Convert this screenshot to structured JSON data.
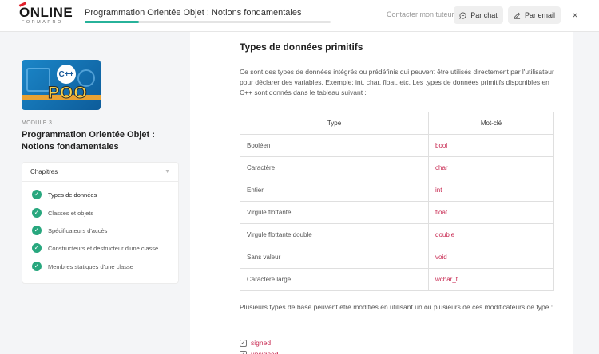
{
  "header": {
    "logo_main": "ONLINE",
    "logo_sub": "FORMAPRO",
    "course_title": "Programmation Orientée Objet : Notions fondamentales",
    "progress_fraction": 0.22,
    "contact_label": "Contacter mon tuteur :",
    "chat_label": "Par chat",
    "email_label": "Par email",
    "close_glyph": "×"
  },
  "sidebar": {
    "thumbnail_text": "POO",
    "thumbnail_badge": "C++",
    "module_label": "MODULE 3",
    "module_title": "Programmation Orientée Objet : Notions fondamentales",
    "chapters_label": "Chapitres",
    "chapters": [
      {
        "label": "Types de données",
        "active": true
      },
      {
        "label": "Classes et objets",
        "active": false
      },
      {
        "label": "Spécificateurs d'accès",
        "active": false
      },
      {
        "label": "Constructeurs et destructeur d'une classe",
        "active": false
      },
      {
        "label": "Membres statiques d'une classe",
        "active": false
      }
    ]
  },
  "content": {
    "title": "Types de données primitifs",
    "intro": "Ce sont des types de données intégrés ou prédéfinis qui peuvent être utilisés directement par l'utilisateur pour déclarer des variables. Exemple: int, char, float, etc. Les types de données primitifs disponibles en C++ sont donnés dans le tableau suivant :",
    "table": {
      "headers": [
        "Type",
        "Mot-clé"
      ],
      "rows": [
        [
          "Booléen",
          "bool"
        ],
        [
          "Caractère",
          "char"
        ],
        [
          "Entier",
          "int"
        ],
        [
          "Virgule flottante",
          "float"
        ],
        [
          "Virgule flottante double",
          "double"
        ],
        [
          "Sans valeur",
          "void"
        ],
        [
          "Caractère large",
          "wchar_t"
        ]
      ]
    },
    "modifiers_intro": "Plusieurs types de base peuvent être modifiés en utilisant un ou plusieurs de ces modificateurs de type :",
    "modifiers": [
      "signed",
      "unsigned"
    ]
  },
  "colors": {
    "accent": "#27b29a",
    "check": "#28a77e",
    "keyword": "#c7254e"
  },
  "icons": {
    "chat": "chat-bubble-icon",
    "email": "pencil-icon",
    "close": "close-icon",
    "check": "check-icon",
    "chevron": "chevron-down-icon",
    "checkbox": "checkbox-icon"
  }
}
